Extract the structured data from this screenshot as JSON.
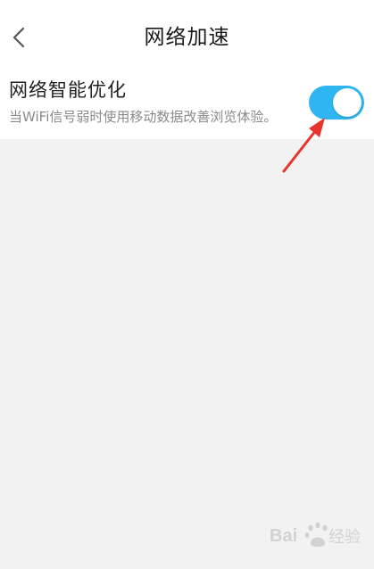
{
  "header": {
    "title": "网络加速",
    "back_icon": "chevron-left-icon"
  },
  "setting": {
    "title": "网络智能优化",
    "description": "当WiFi信号弱时使用移动数据改善浏览体验。",
    "toggle_state": "on",
    "toggle_color": "#2fb6f0"
  },
  "annotation": {
    "arrow_color": "#e8342c"
  },
  "watermark": {
    "text": "Bai du 经验"
  }
}
